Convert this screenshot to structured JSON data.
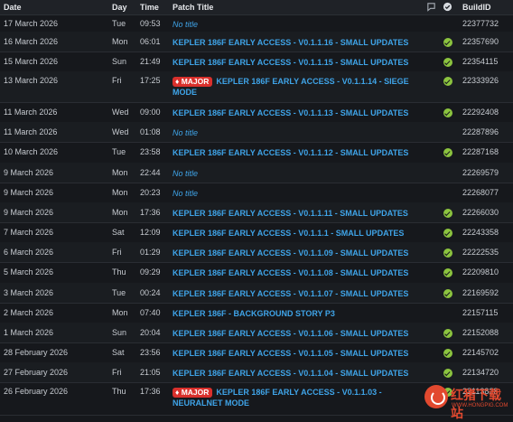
{
  "header": {
    "date": "Date",
    "day": "Day",
    "time": "Time",
    "title": "Patch Title",
    "comment_icon": "comment-icon",
    "verified_icon": "verified-check-icon",
    "build": "BuildID"
  },
  "rows": [
    {
      "date": "17 March 2026",
      "day": "Tue",
      "time": "09:53",
      "title": "No title",
      "kind": "none",
      "checked": false,
      "build": "22377732"
    },
    {
      "date": "16 March 2026",
      "day": "Mon",
      "time": "06:01",
      "title": "KEPLER 186F EARLY ACCESS - V0.1.1.16 - SMALL UPDATES",
      "kind": "link",
      "checked": true,
      "build": "22357690"
    },
    {
      "date": "15 March 2026",
      "day": "Sun",
      "time": "21:49",
      "title": "KEPLER 186F EARLY ACCESS - V0.1.1.15 - SMALL UPDATES",
      "kind": "link",
      "checked": true,
      "build": "22354115"
    },
    {
      "date": "13 March 2026",
      "day": "Fri",
      "time": "17:25",
      "badge": "MAJOR",
      "title": "KEPLER 186F EARLY ACCESS - V0.1.1.14 - SIEGE MODE",
      "kind": "link",
      "checked": true,
      "build": "22333926"
    },
    {
      "date": "11 March 2026",
      "day": "Wed",
      "time": "09:00",
      "title": "KEPLER 186F EARLY ACCESS - V0.1.1.13 - SMALL UPDATES",
      "kind": "link",
      "checked": true,
      "build": "22292408"
    },
    {
      "date": "11 March 2026",
      "day": "Wed",
      "time": "01:08",
      "title": "No title",
      "kind": "none",
      "checked": false,
      "build": "22287896"
    },
    {
      "date": "10 March 2026",
      "day": "Tue",
      "time": "23:58",
      "title": "KEPLER 186F EARLY ACCESS - V0.1.1.12 - SMALL UPDATES",
      "kind": "link",
      "checked": true,
      "build": "22287168"
    },
    {
      "date": "9 March 2026",
      "day": "Mon",
      "time": "22:44",
      "title": "No title",
      "kind": "none",
      "checked": false,
      "build": "22269579"
    },
    {
      "date": "9 March 2026",
      "day": "Mon",
      "time": "20:23",
      "title": "No title",
      "kind": "none",
      "checked": false,
      "build": "22268077"
    },
    {
      "date": "9 March 2026",
      "day": "Mon",
      "time": "17:36",
      "title": "KEPLER 186F EARLY ACCESS - V0.1.1.11 - SMALL UPDATES",
      "kind": "link",
      "checked": true,
      "build": "22266030"
    },
    {
      "date": "7 March 2026",
      "day": "Sat",
      "time": "12:09",
      "title": "KEPLER 186F EARLY ACCESS - V0.1.1.1 - SMALL UPDATES",
      "kind": "link",
      "checked": true,
      "build": "22243358"
    },
    {
      "date": "6 March 2026",
      "day": "Fri",
      "time": "01:29",
      "title": "KEPLER 186F EARLY ACCESS - V0.1.1.09 - SMALL UPDATES",
      "kind": "link",
      "checked": true,
      "build": "22222535"
    },
    {
      "date": "5 March 2026",
      "day": "Thu",
      "time": "09:29",
      "title": "KEPLER 186F EARLY ACCESS - V0.1.1.08 - SMALL UPDATES",
      "kind": "link",
      "checked": true,
      "build": "22209810"
    },
    {
      "date": "3 March 2026",
      "day": "Tue",
      "time": "00:24",
      "title": "KEPLER 186F EARLY ACCESS - V0.1.1.07 - SMALL UPDATES",
      "kind": "link",
      "checked": true,
      "build": "22169592"
    },
    {
      "date": "2 March 2026",
      "day": "Mon",
      "time": "07:40",
      "title": "KEPLER 186F - BACKGROUND STORY P3",
      "kind": "link",
      "checked": false,
      "build": "22157115"
    },
    {
      "date": "1 March 2026",
      "day": "Sun",
      "time": "20:04",
      "title": "KEPLER 186F EARLY ACCESS - V0.1.1.06 - SMALL UPDATES",
      "kind": "link",
      "checked": true,
      "build": "22152088"
    },
    {
      "date": "28 February 2026",
      "day": "Sat",
      "time": "23:56",
      "title": "KEPLER 186F EARLY ACCESS - V0.1.1.05 - SMALL UPDATES",
      "kind": "link",
      "checked": true,
      "build": "22145702"
    },
    {
      "date": "27 February 2026",
      "day": "Fri",
      "time": "21:05",
      "title": "KEPLER 186F EARLY ACCESS - V0.1.1.04 - SMALL UPDATES",
      "kind": "link",
      "checked": true,
      "build": "22134720"
    },
    {
      "date": "26 February 2026",
      "day": "Thu",
      "time": "17:36",
      "badge": "MAJOR",
      "title": "KEPLER 186F EARLY ACCESS - V0.1.1.03 - NEURALNET MODE",
      "kind": "link",
      "checked": true,
      "build": "22113828"
    }
  ],
  "watermark": {
    "main": "红猪下载站",
    "sub": "WWW.HONGPIG.COM"
  },
  "colors": {
    "link": "#3fa4e8",
    "badge": "#d9302c",
    "check": "#8cc43f"
  }
}
